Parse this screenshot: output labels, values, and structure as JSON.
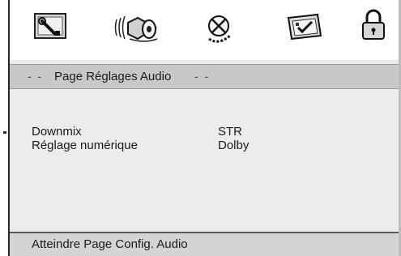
{
  "toolbar": {
    "icons": [
      "wrench-icon",
      "speaker-icon",
      "no-sign-icon",
      "video-icon",
      "padlock-icon"
    ]
  },
  "page_header": {
    "dash_left": "- -",
    "title": "Page Réglages Audio",
    "dash_right": "- -"
  },
  "settings": [
    {
      "label": "Downmix",
      "value": "STR"
    },
    {
      "label": "Réglage numérique",
      "value": "Dolby"
    }
  ],
  "status_bar": {
    "text": "Atteindre Page Config. Audio"
  }
}
